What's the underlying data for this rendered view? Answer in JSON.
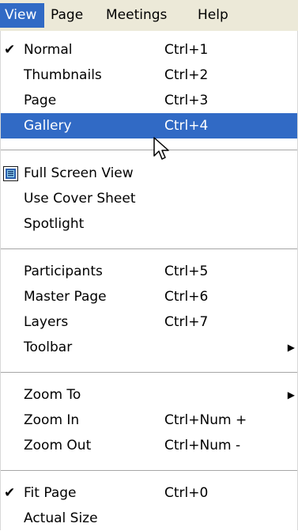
{
  "menubar": {
    "items": [
      {
        "label": "View",
        "active": true
      },
      {
        "label": "Page"
      },
      {
        "label": "Meetings"
      },
      {
        "label": "Help"
      }
    ]
  },
  "view_menu": {
    "groups": [
      [
        {
          "label": "Normal",
          "shortcut": "Ctrl+1",
          "checked": true
        },
        {
          "label": "Thumbnails",
          "shortcut": "Ctrl+2"
        },
        {
          "label": "Page",
          "shortcut": "Ctrl+3"
        },
        {
          "label": "Gallery",
          "shortcut": "Ctrl+4",
          "highlighted": true
        }
      ],
      [
        {
          "label": "Full Screen View",
          "icon": "full-screen-icon"
        },
        {
          "label": "Use Cover Sheet"
        },
        {
          "label": "Spotlight"
        }
      ],
      [
        {
          "label": "Participants",
          "shortcut": "Ctrl+5"
        },
        {
          "label": "Master Page",
          "shortcut": "Ctrl+6"
        },
        {
          "label": "Layers",
          "shortcut": "Ctrl+7"
        },
        {
          "label": "Toolbar",
          "submenu": true
        }
      ],
      [
        {
          "label": "Zoom To",
          "submenu": true
        },
        {
          "label": "Zoom In",
          "shortcut": "Ctrl+Num +"
        },
        {
          "label": "Zoom Out",
          "shortcut": "Ctrl+Num -"
        }
      ],
      [
        {
          "label": "Fit Page",
          "shortcut": "Ctrl+0",
          "checked": true
        },
        {
          "label": "Actual Size"
        }
      ]
    ]
  },
  "colors": {
    "highlight": "#316ac5",
    "menubar_bg": "#ece9d8"
  },
  "glyphs": {
    "check": "✔",
    "submenu_arrow": "▶"
  }
}
